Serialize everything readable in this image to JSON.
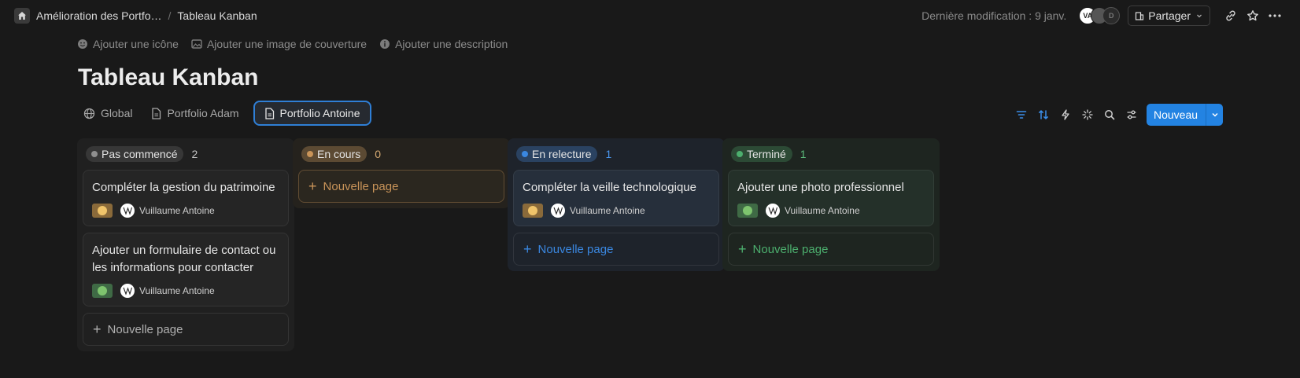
{
  "breadcrumb": {
    "parent": "Amélioration des Portfo…",
    "separator": "/",
    "current": "Tableau Kanban"
  },
  "topbar": {
    "last_modified": "Dernière modification : 9 janv.",
    "avatar_letters": [
      "VA",
      "",
      "D"
    ],
    "share_label": "Partager"
  },
  "page_actions": {
    "add_icon": "Ajouter une icône",
    "add_cover": "Ajouter une image de couverture",
    "add_description": "Ajouter une description"
  },
  "page_title": "Tableau Kanban",
  "views": [
    {
      "label": "Global",
      "icon": "globe-icon"
    },
    {
      "label": "Portfolio Adam",
      "icon": "document-icon"
    },
    {
      "label": "Portfolio Antoine",
      "icon": "document-icon",
      "active": true
    }
  ],
  "toolbar": {
    "new_label": "Nouveau"
  },
  "board": {
    "columns": [
      {
        "name": "Pas commencé",
        "count": "2",
        "colors": {
          "bg": "#202020",
          "pill": "#373737",
          "dot": "#8f8f8f",
          "text": "#c4c4c4",
          "card": "#252525",
          "accent": "#b0b0b0"
        },
        "cards": [
          {
            "title": "Compléter la gestion du patrimoine",
            "tag": "orange",
            "assignee": "Vuillaume Antoine"
          },
          {
            "title": "Ajouter un formulaire de contact ou les informations pour contacter",
            "tag": "green",
            "assignee": "Vuillaume Antoine"
          }
        ],
        "new_page": "Nouvelle page"
      },
      {
        "name": "En cours",
        "count": "0",
        "colors": {
          "bg": "#25221d",
          "pill": "#5c4a33",
          "dot": "#c99459",
          "text": "#d6aa72",
          "card": "#2b271f",
          "accent": "#c99459"
        },
        "cards": [],
        "new_page": "Nouvelle page"
      },
      {
        "name": "En relecture",
        "count": "1",
        "colors": {
          "bg": "#1e232b",
          "pill": "#2a4261",
          "dot": "#3a87e0",
          "text": "#4a97ef",
          "card": "#262f3b",
          "accent": "#3a87e0"
        },
        "cards": [
          {
            "title": "Compléter la veille technologique",
            "tag": "orange",
            "assignee": "Vuillaume Antoine"
          }
        ],
        "new_page": "Nouvelle page"
      },
      {
        "name": "Terminé",
        "count": "1",
        "colors": {
          "bg": "#1e2520",
          "pill": "#2c4a35",
          "dot": "#4caf6e",
          "text": "#5cbc7c",
          "card": "#243029",
          "accent": "#4caf6e"
        },
        "cards": [
          {
            "title": "Ajouter une photo professionnel",
            "tag": "green",
            "assignee": "Vuillaume Antoine"
          }
        ],
        "new_page": "Nouvelle page"
      }
    ]
  },
  "tag_colors": {
    "orange": {
      "bg": "#8a6a3a",
      "dot": "#f0c46a"
    },
    "green": {
      "bg": "#3f6a45",
      "dot": "#7ec46e"
    }
  }
}
